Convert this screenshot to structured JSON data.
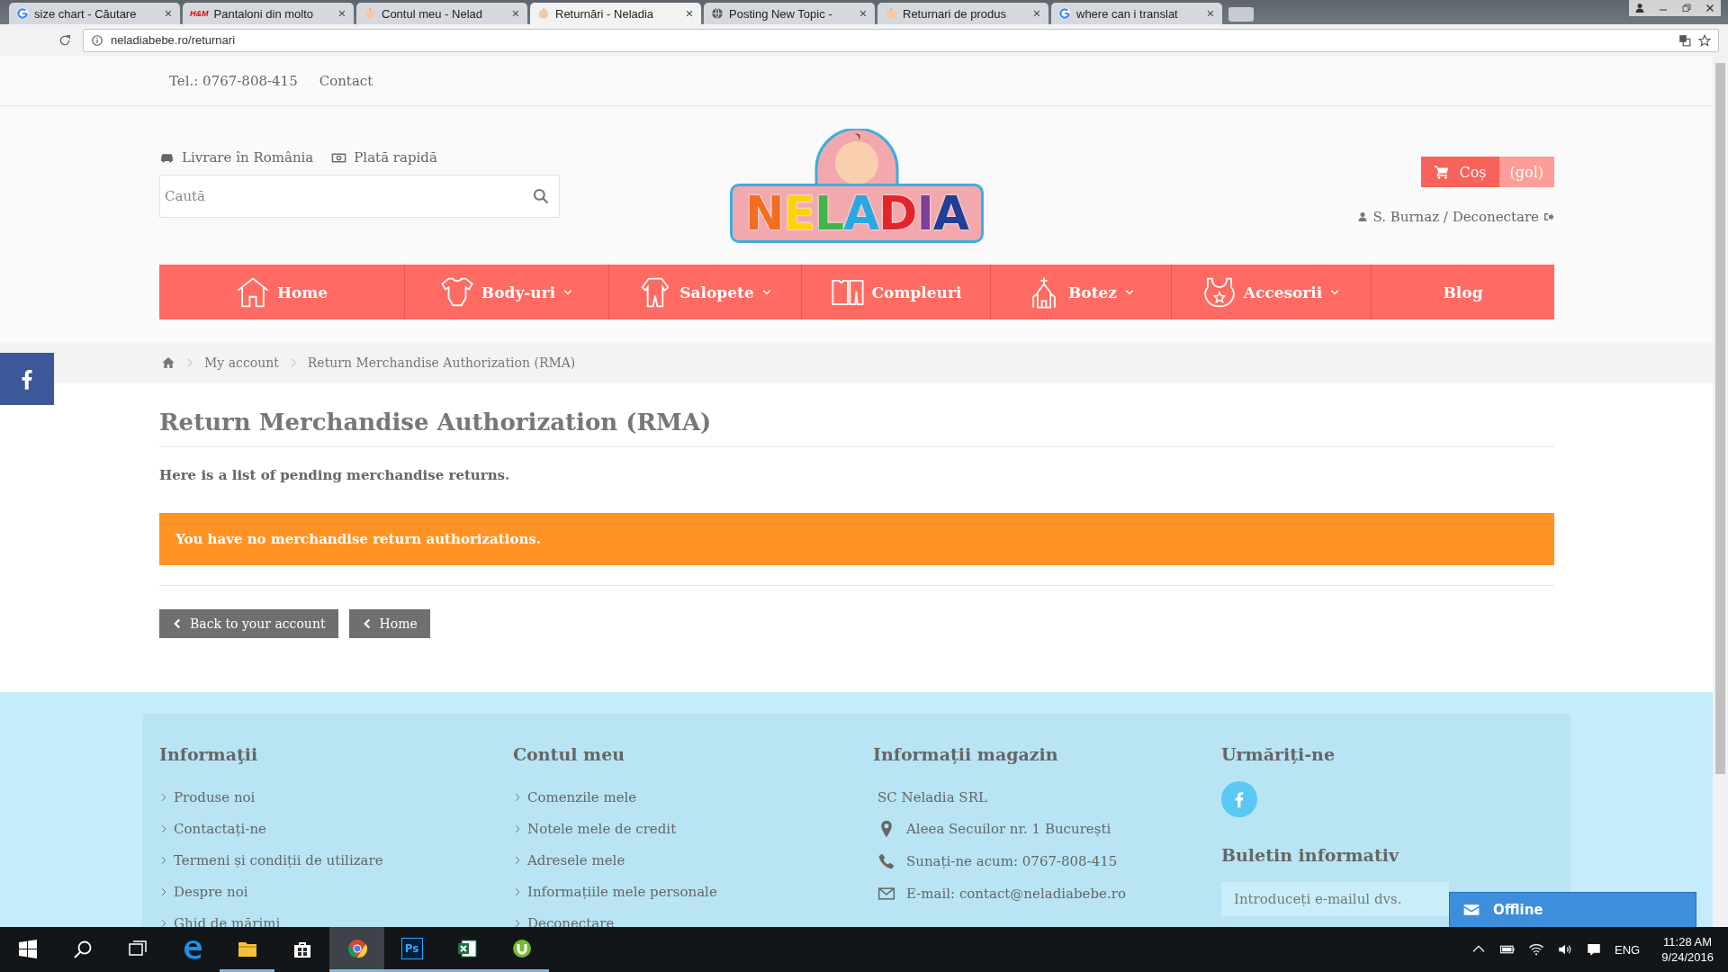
{
  "browser": {
    "tabs": [
      {
        "kind": "google",
        "title": "size chart - Căutare",
        "selected": false
      },
      {
        "kind": "text",
        "favicon_text": "H&M",
        "title": "Pantaloni din molto",
        "selected": false
      },
      {
        "kind": "baby",
        "title": "Contul meu - Nelad",
        "selected": false
      },
      {
        "kind": "baby",
        "title": "Returnări - Neladia",
        "selected": true
      },
      {
        "kind": "globe",
        "title": "Posting New Topic -",
        "selected": false
      },
      {
        "kind": "baby",
        "title": "Returnari de produs",
        "selected": false
      },
      {
        "kind": "google",
        "title": "where can i translat",
        "selected": false
      }
    ],
    "address": "neladiabebe.ro/returnari"
  },
  "topbar": [
    "Tel.: 0767-808-415",
    "Contact"
  ],
  "header": {
    "features": [
      {
        "kind": "car",
        "text": "Livrare în România"
      },
      {
        "kind": "money",
        "text": "Plată rapidă"
      }
    ],
    "search": {
      "placeholder": "Caută"
    },
    "logo": {
      "text": "NELADIA"
    },
    "cart": {
      "label": "Coș",
      "status": "(gol)"
    },
    "user": "S. Burnaz / Deconectare"
  },
  "nav": [
    {
      "kind": "house",
      "label": "Home",
      "dropdown": false
    },
    {
      "kind": "bodysuit",
      "label": "Body-uri",
      "dropdown": true
    },
    {
      "kind": "onesie",
      "label": "Salopete",
      "dropdown": true
    },
    {
      "kind": "clothes",
      "label": "Compleuri",
      "dropdown": false
    },
    {
      "kind": "church",
      "label": "Botez",
      "dropdown": true
    },
    {
      "kind": "bib",
      "label": "Accesorii",
      "dropdown": true
    },
    {
      "kind": "plain",
      "label": "Blog",
      "dropdown": false
    }
  ],
  "breadcrumb": [
    "My account",
    "Return Merchandise Authorization (RMA)"
  ],
  "page": {
    "title": "Return Merchandise Authorization (RMA)",
    "intro": "Here is a list of pending merchandise returns.",
    "alert": "You have no merchandise return authorizations.",
    "buttons": [
      "Back to your account",
      "Home"
    ]
  },
  "footer": {
    "columns": [
      {
        "kind": "links",
        "heading": "Informaţii",
        "items": [
          "Produse noi",
          "Contactați-ne",
          "Termeni și condiții de utilizare",
          "Despre noi",
          "Ghid de mărimi"
        ]
      },
      {
        "kind": "links",
        "heading": "Contul meu",
        "items": [
          "Comenzile mele",
          "Notele mele de credit",
          "Adresele mele",
          "Informațiile mele personale",
          "Deconectare"
        ]
      },
      {
        "kind": "contact",
        "heading": "Informații magazin",
        "company": "SC Neladia SRL",
        "items": [
          {
            "kind": "pin",
            "text": "Aleea Secuilor nr. 1 București"
          },
          {
            "kind": "phone",
            "text": "Sunați-ne acum: 0767-808-415"
          },
          {
            "kind": "mail",
            "text": "E-mail: contact@neladiabebe.ro"
          }
        ]
      },
      {
        "kind": "social",
        "heading": "Urmăriți-ne",
        "newsletter_heading": "Buletin informativ",
        "newsletter": {
          "placeholder": "Introduceți e-mailul dvs."
        }
      }
    ]
  },
  "chat": {
    "label": "Offline"
  },
  "taskbar": {
    "apps": [
      {
        "kind": "edge",
        "running": false,
        "selected": false
      },
      {
        "kind": "folder",
        "running": true,
        "selected": false
      },
      {
        "kind": "store",
        "running": false,
        "selected": false
      },
      {
        "kind": "chrome",
        "running": true,
        "selected": true
      },
      {
        "kind": "glyph",
        "glyph": "Ps",
        "running": true,
        "selected": false
      },
      {
        "kind": "excel",
        "running": true,
        "selected": false
      },
      {
        "kind": "utorrent",
        "running": true,
        "selected": false
      }
    ],
    "language": "ENG",
    "time": "11:28 AM",
    "date": "9/24/2016"
  }
}
